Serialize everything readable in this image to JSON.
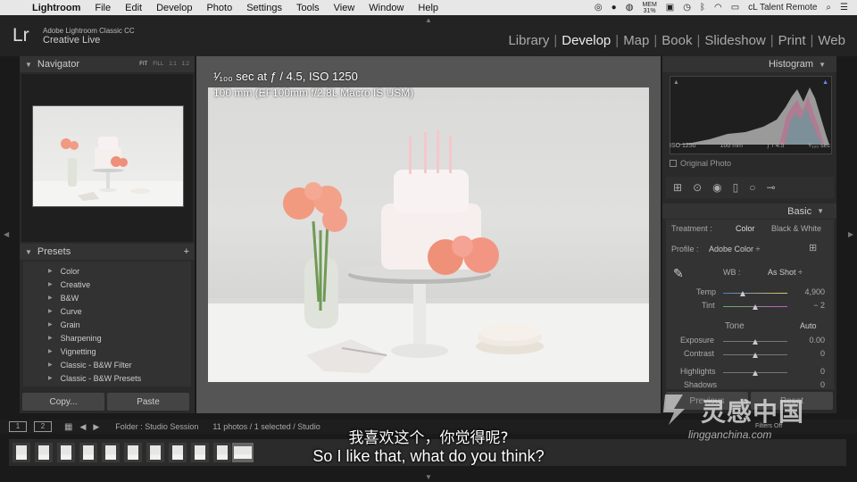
{
  "menubar": {
    "app": "Lightroom",
    "items": [
      "File",
      "Edit",
      "Develop",
      "Photo",
      "Settings",
      "Tools",
      "View",
      "Window",
      "Help"
    ],
    "mem": "MEM\n31%",
    "account": "cL Talent Remote"
  },
  "header": {
    "logo": "Lr",
    "product_line1": "Adobe Lightroom Classic CC",
    "product_line2": "Creative Live",
    "modules": [
      "Library",
      "Develop",
      "Map",
      "Book",
      "Slideshow",
      "Print",
      "Web"
    ],
    "active_module": "Develop"
  },
  "navigator": {
    "title": "Navigator",
    "options": [
      "FIT",
      "FILL",
      "1:1",
      "1:2"
    ]
  },
  "presets": {
    "title": "Presets",
    "items": [
      "Color",
      "Creative",
      "B&W",
      "Curve",
      "Grain",
      "Sharpening",
      "Vignetting",
      "Classic - B&W Filter",
      "Classic - B&W Presets"
    ]
  },
  "left_buttons": {
    "copy": "Copy...",
    "paste": "Paste"
  },
  "photo": {
    "exif_line1": "¹⁄₁₀₀ sec at ƒ / 4.5, ISO 1250",
    "exif_line2": "100 mm (EF100mm f/2.8L Macro IS USM)"
  },
  "histogram": {
    "title": "Histogram",
    "iso": "ISO 1250",
    "focal": "100 mm",
    "aperture": "ƒ / 4.5",
    "shutter": "¹⁄₁₀₀ sec",
    "original_photo": "Original Photo"
  },
  "basic": {
    "title": "Basic",
    "treatment_label": "Treatment :",
    "treatment_color": "Color",
    "treatment_bw": "Black & White",
    "profile_label": "Profile :",
    "profile_value": "Adobe Color ÷",
    "wb_label": "WB :",
    "wb_value": "As Shot ÷",
    "temp_label": "Temp",
    "temp_value": "4,900",
    "tint_label": "Tint",
    "tint_value": "− 2",
    "tone_label": "Tone",
    "auto_label": "Auto",
    "exposure_label": "Exposure",
    "exposure_value": "0.00",
    "contrast_label": "Contrast",
    "contrast_value": "0",
    "highlights_label": "Highlights",
    "highlights_value": "0",
    "shadows_label": "Shadows",
    "shadows_value": "0"
  },
  "right_buttons": {
    "previous": "Previous",
    "reset": "Reset"
  },
  "filmbar": {
    "view1": "1",
    "view2": "2",
    "source": "Folder : Studio Session",
    "count": "11 photos / 1 selected / Studio",
    "filters": "Filters Off"
  },
  "subtitles": {
    "chinese": "我喜欢这个，你觉得呢?",
    "english": "So I like that, what do you think?"
  },
  "watermark": {
    "cn": "灵感中国",
    "en": "lingganchina.com"
  }
}
